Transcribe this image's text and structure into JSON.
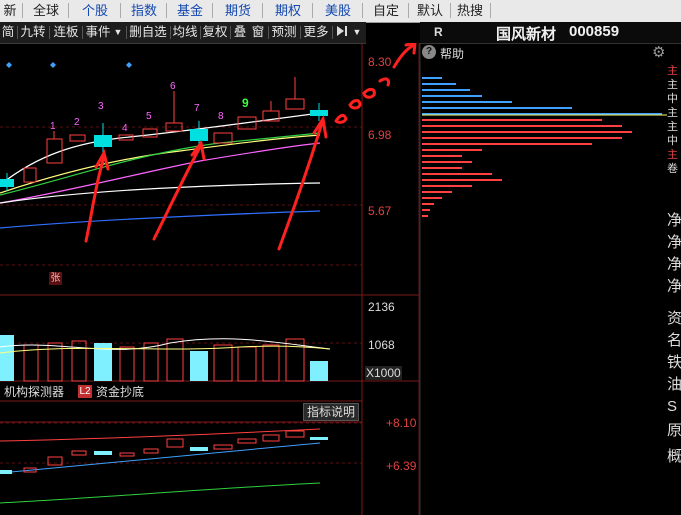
{
  "top_tabs": {
    "left_cut": "新股",
    "all": "全球",
    "stocks": "个股",
    "index": "指数",
    "funds": "基金",
    "futures": "期货",
    "options": "期权",
    "us_stocks": "美股",
    "custom": "自定",
    "default": "默认",
    "hot": "热搜"
  },
  "toolbar": {
    "simple": "简",
    "nine": "九转",
    "limit_board": "连板",
    "events": "事件",
    "delete_watch": "删自选",
    "ma": "均线",
    "adjust": "复权",
    "overlay": "叠",
    "window": "窗",
    "forecast": "预测",
    "more": "更多"
  },
  "right_header": {
    "r_label": "R",
    "stock_name": "国风新材",
    "stock_code": "000859",
    "help": "帮助"
  },
  "price_axis": {
    "top": "8.30",
    "mid": "6.98",
    "low": "5.67"
  },
  "nine_turn_labels": [
    "1",
    "2",
    "3",
    "4",
    "5",
    "6",
    "7",
    "8",
    "9"
  ],
  "zhang_badge": "张",
  "volume_axis": {
    "high": "2136",
    "mid": "1068",
    "unit": "X1000"
  },
  "lower_tabs": {
    "institution": "机构探测器",
    "l2_badge": "L2",
    "fund_copy": "资金抄底",
    "indicator_help": "指标说明"
  },
  "indicator_axis": {
    "high": "+8.10",
    "low": "+6.39"
  },
  "right_side_chars": [
    "主",
    "主",
    "中",
    "主",
    "主",
    "中",
    "主",
    "卷",
    "净",
    "净",
    "净",
    "净",
    "资",
    "名",
    "铁",
    "油",
    "S",
    "原",
    "概"
  ],
  "colors": {
    "up": "#ff4040",
    "down": "#00e0e0",
    "vol_down": "#7ef0ff",
    "hand": "#ff2222",
    "accent_blue": "#1248b0"
  },
  "icons": [
    "pencil-icon",
    "eye-icon",
    "rect-select-icon",
    "hand-icon",
    "lock-icon",
    "zoom-in-icon",
    "zoom-out-icon",
    "settings-icon",
    "help-icon",
    "play-icon",
    "dropdown-icon"
  ]
}
